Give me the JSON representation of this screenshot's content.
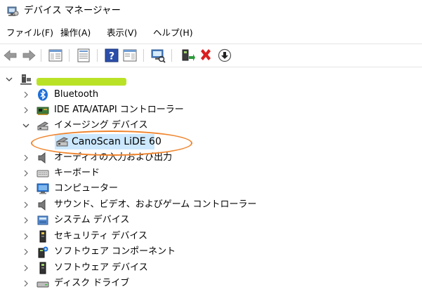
{
  "window": {
    "title": "デバイス マネージャー"
  },
  "menu": [
    "ファイル(F)",
    "操作(A)",
    "表示(V)",
    "ヘルプ(H)"
  ],
  "tree": {
    "root_label": "",
    "categories": [
      {
        "label": "Bluetooth",
        "expanded": false
      },
      {
        "label": "IDE ATA/ATAPI コントローラー",
        "expanded": false
      },
      {
        "label": "イメージング デバイス",
        "expanded": true,
        "children": [
          "CanoScan LiDE 60"
        ]
      },
      {
        "label": "オーディオの入力および出力",
        "expanded": false
      },
      {
        "label": "キーボード",
        "expanded": false
      },
      {
        "label": "コンピューター",
        "expanded": false
      },
      {
        "label": "サウンド、ビデオ、およびゲーム コントローラー",
        "expanded": false
      },
      {
        "label": "システム デバイス",
        "expanded": false
      },
      {
        "label": "セキュリティ デバイス",
        "expanded": false
      },
      {
        "label": "ソフトウェア コンポーネント",
        "expanded": false
      },
      {
        "label": "ソフトウェア デバイス",
        "expanded": false
      },
      {
        "label": "ディスク ドライブ",
        "expanded": false
      }
    ]
  },
  "colors": {
    "selection": "#cce8ff",
    "highlight_ellipse": "#f0842c",
    "name_redaction": "#b9e226"
  }
}
